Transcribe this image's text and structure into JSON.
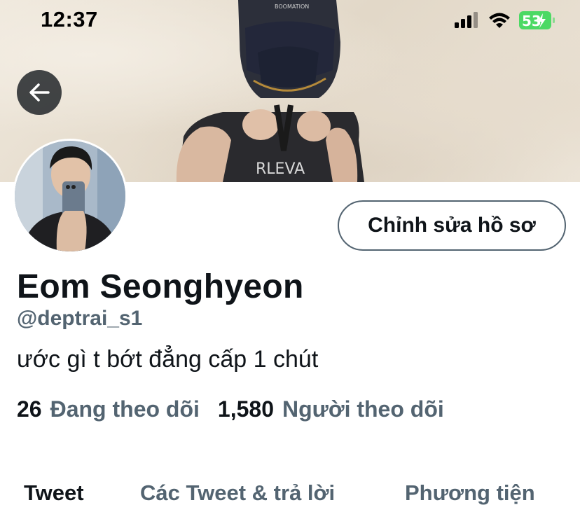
{
  "status_bar": {
    "time": "12:37",
    "battery": "53",
    "icons": [
      "signal-icon",
      "wifi-icon",
      "battery-charging-icon"
    ]
  },
  "profile": {
    "display_name": "Eom Seonghyeon",
    "handle": "@deptrai_s1",
    "bio": "ước gì t bớt đẳng cấp 1 chút",
    "edit_button_label": "Chỉnh sửa hồ sơ",
    "following_count": "26",
    "following_label": "Đang theo dõi",
    "followers_count": "1,580",
    "followers_label": "Người theo dõi"
  },
  "tabs": [
    {
      "label": "Tweet",
      "active": true
    },
    {
      "label": "Các Tweet & trả lời",
      "active": false
    },
    {
      "label": "Phương tiện",
      "active": false
    }
  ],
  "colors": {
    "text_primary": "#0f1419",
    "text_secondary": "#536471",
    "battery_green": "#4cd964"
  }
}
